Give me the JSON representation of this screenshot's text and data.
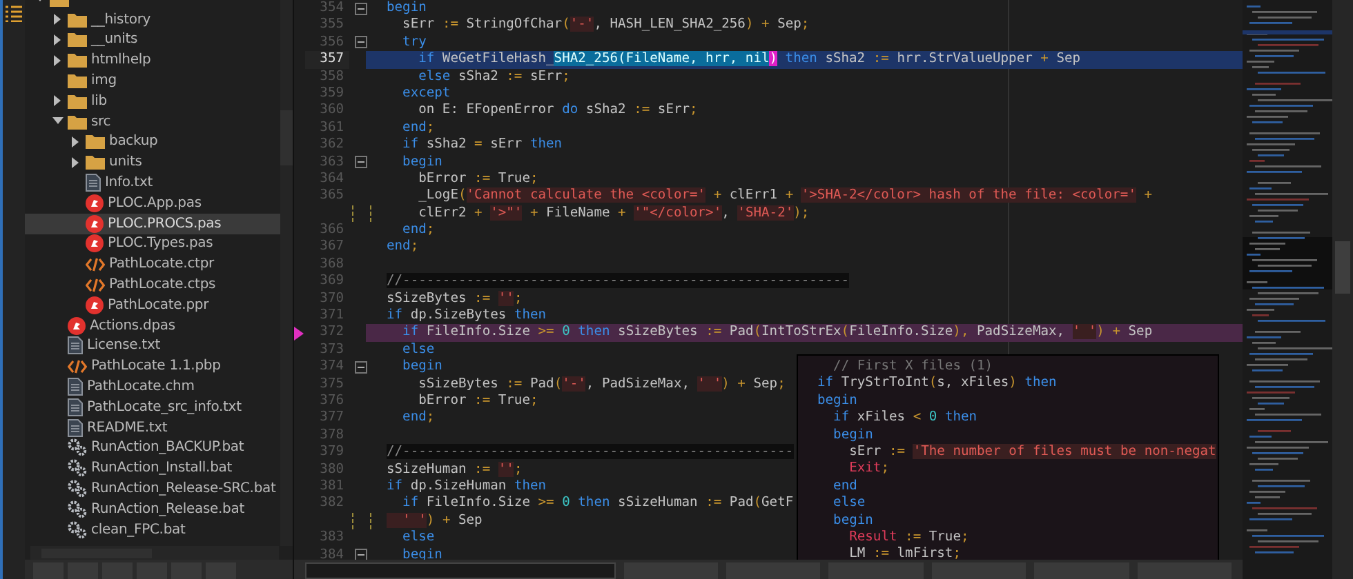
{
  "tree": {
    "items": [
      {
        "kind": "folder",
        "expanded": true,
        "selected": false,
        "children": [
          {
            "kind": "folder",
            "label": "__history",
            "expanded": false,
            "selected": false
          },
          {
            "kind": "folder",
            "label": "__units",
            "expanded": false,
            "selected": false
          },
          {
            "kind": "folder",
            "label": "htmlhelp",
            "expanded": false,
            "selected": false
          },
          {
            "kind": "folder",
            "label": "img",
            "selected": false
          },
          {
            "kind": "folder",
            "label": "lib",
            "expanded": false,
            "selected": false
          },
          {
            "kind": "folder",
            "label": "src",
            "expanded": true,
            "selected": false,
            "children": [
              {
                "kind": "folder",
                "label": "backup",
                "expanded": false,
                "selected": false
              },
              {
                "kind": "folder",
                "label": "units",
                "expanded": false,
                "selected": false
              },
              {
                "kind": "text",
                "label": "Info.txt",
                "selected": false
              },
              {
                "kind": "pascal",
                "label": "PLOC.App.pas",
                "selected": false
              },
              {
                "kind": "pascal",
                "label": "PLOC.PROCS.pas",
                "selected": true
              },
              {
                "kind": "pascal",
                "label": "PLOC.Types.pas",
                "selected": false
              },
              {
                "kind": "xml",
                "label": "PathLocate.ctpr",
                "selected": false
              },
              {
                "kind": "xml",
                "label": "PathLocate.ctps",
                "selected": false
              },
              {
                "kind": "pascal",
                "label": "PathLocate.ppr",
                "selected": false
              }
            ]
          },
          {
            "kind": "pascal",
            "label": "Actions.dpas",
            "selected": false
          },
          {
            "kind": "text",
            "label": "License.txt",
            "selected": false
          },
          {
            "kind": "xml",
            "label": "PathLocate 1.1.pbp",
            "selected": false
          },
          {
            "kind": "text",
            "label": "PathLocate.chm",
            "selected": false
          },
          {
            "kind": "text",
            "label": "PathLocate_src_info.txt",
            "selected": false
          },
          {
            "kind": "text",
            "label": "README.txt",
            "selected": false
          },
          {
            "kind": "gear",
            "label": "RunAction_BACKUP.bat",
            "selected": false
          },
          {
            "kind": "gear",
            "label": "RunAction_Install.bat",
            "selected": false
          },
          {
            "kind": "gear",
            "label": "RunAction_Release-SRC.bat",
            "selected": false
          },
          {
            "kind": "gear",
            "label": "RunAction_Release.bat",
            "selected": false
          },
          {
            "kind": "gear",
            "label": "clean_FPC.bat",
            "selected": false
          }
        ]
      }
    ]
  },
  "editor": {
    "lines": [
      {
        "kind": "code",
        "number": "354",
        "fold": true,
        "tokens": [
          {
            "kind": "kw",
            "text": "begin"
          }
        ]
      },
      {
        "kind": "code",
        "number": "355",
        "fold": false,
        "tokens": [
          {
            "kind": "id",
            "text": "  sErr "
          },
          {
            "kind": "op",
            "text": ":="
          },
          {
            "kind": "id",
            "text": " StringOfChar"
          },
          {
            "kind": "op",
            "text": "("
          },
          {
            "kind": "str",
            "text": "'-'"
          },
          {
            "kind": "id",
            "text": ", HASH_LEN_SHA2_256"
          },
          {
            "kind": "op",
            "text": ")"
          },
          {
            "kind": "op",
            "text": " +"
          },
          {
            "kind": "id",
            "text": " Sep"
          },
          {
            "kind": "op",
            "text": ";"
          }
        ]
      },
      {
        "kind": "code",
        "number": "356",
        "fold": true,
        "tokens": [
          {
            "kind": "kw",
            "text": "  try"
          }
        ]
      },
      {
        "kind": "current",
        "number": "357",
        "fold": false,
        "tokens": [
          {
            "kind": "kw",
            "text": "    if"
          },
          {
            "kind": "id",
            "text": " WeGetFileHash_"
          },
          {
            "kind": "match",
            "text": "SHA2_256(FileName, hrr, nil"
          },
          {
            "kind": "bracket",
            "text": ")"
          },
          {
            "kind": "kw",
            "text": " then"
          },
          {
            "kind": "id",
            "text": " sSha2 "
          },
          {
            "kind": "op",
            "text": ":="
          },
          {
            "kind": "id",
            "text": " hrr.StrValueUpper "
          },
          {
            "kind": "op",
            "text": "+"
          },
          {
            "kind": "id",
            "text": " Sep"
          }
        ]
      },
      {
        "kind": "code",
        "number": "358",
        "fold": false,
        "tokens": [
          {
            "kind": "kw",
            "text": "    else"
          },
          {
            "kind": "id",
            "text": " sSha2 "
          },
          {
            "kind": "op",
            "text": ":="
          },
          {
            "kind": "id",
            "text": " sErr"
          },
          {
            "kind": "op",
            "text": ";"
          }
        ]
      },
      {
        "kind": "code",
        "number": "359",
        "fold": false,
        "tokens": [
          {
            "kind": "kw",
            "text": "  except"
          }
        ]
      },
      {
        "kind": "code",
        "number": "360",
        "fold": false,
        "tokens": [
          {
            "kind": "id",
            "text": "    on E: EFopenError "
          },
          {
            "kind": "kw",
            "text": "do"
          },
          {
            "kind": "id",
            "text": " sSha2 "
          },
          {
            "kind": "op",
            "text": ":="
          },
          {
            "kind": "id",
            "text": " sErr"
          },
          {
            "kind": "op",
            "text": ";"
          }
        ]
      },
      {
        "kind": "code",
        "number": "361",
        "fold": false,
        "tokens": [
          {
            "kind": "kw",
            "text": "  end"
          },
          {
            "kind": "op",
            "text": ";"
          }
        ]
      },
      {
        "kind": "code",
        "number": "362",
        "fold": false,
        "tokens": [
          {
            "kind": "kw",
            "text": "  if"
          },
          {
            "kind": "id",
            "text": " sSha2 "
          },
          {
            "kind": "op",
            "text": "="
          },
          {
            "kind": "id",
            "text": " sErr "
          },
          {
            "kind": "kw",
            "text": "then"
          }
        ]
      },
      {
        "kind": "code",
        "number": "363",
        "fold": true,
        "tokens": [
          {
            "kind": "kw",
            "text": "  begin"
          }
        ]
      },
      {
        "kind": "code",
        "number": "364",
        "fold": false,
        "tokens": [
          {
            "kind": "id",
            "text": "    bError "
          },
          {
            "kind": "op",
            "text": ":="
          },
          {
            "kind": "id",
            "text": " True"
          },
          {
            "kind": "op",
            "text": ";"
          }
        ]
      },
      {
        "kind": "code",
        "number": "365",
        "fold": false,
        "tokens": [
          {
            "kind": "id",
            "text": "    _LogE"
          },
          {
            "kind": "op",
            "text": "("
          },
          {
            "kind": "str",
            "text": "'Cannot calculate the <color='"
          },
          {
            "kind": "op",
            "text": " +"
          },
          {
            "kind": "id",
            "text": " clErr1"
          },
          {
            "kind": "op",
            "text": " + "
          },
          {
            "kind": "str",
            "text": "'>SHA-2</color> hash of the file: <color='"
          },
          {
            "kind": "op",
            "text": " +"
          }
        ]
      },
      {
        "kind": "wrap",
        "fold": false,
        "tokens": [
          {
            "kind": "id",
            "text": "    clErr2"
          },
          {
            "kind": "op",
            "text": " + "
          },
          {
            "kind": "str",
            "text": "'>\"'"
          },
          {
            "kind": "op",
            "text": " +"
          },
          {
            "kind": "id",
            "text": " FileName"
          },
          {
            "kind": "op",
            "text": " + "
          },
          {
            "kind": "str",
            "text": "'\"</color>'"
          },
          {
            "kind": "id",
            "text": ", "
          },
          {
            "kind": "str",
            "text": "'SHA-2'"
          },
          {
            "kind": "op",
            "text": ");"
          }
        ]
      },
      {
        "kind": "code",
        "number": "366",
        "fold": false,
        "tokens": [
          {
            "kind": "kw",
            "text": "  end"
          },
          {
            "kind": "op",
            "text": ";"
          }
        ]
      },
      {
        "kind": "code",
        "number": "367",
        "fold": false,
        "tokens": [
          {
            "kind": "kw",
            "text": "end"
          },
          {
            "kind": "op",
            "text": ";"
          }
        ]
      },
      {
        "kind": "code",
        "number": "368",
        "fold": false
      },
      {
        "kind": "separator",
        "number": "369",
        "fold": false,
        "tokens": [
          {
            "kind": "cmt",
            "text": "//--------------------------------------------------------"
          }
        ]
      },
      {
        "kind": "code",
        "number": "370",
        "fold": false,
        "tokens": [
          {
            "kind": "id",
            "text": "sSizeBytes "
          },
          {
            "kind": "op",
            "text": ":= "
          },
          {
            "kind": "str",
            "text": "''"
          },
          {
            "kind": "op",
            "text": ";"
          }
        ]
      },
      {
        "kind": "code",
        "number": "371",
        "fold": false,
        "tokens": [
          {
            "kind": "kw",
            "text": "if"
          },
          {
            "kind": "id",
            "text": " dp.SizeBytes "
          },
          {
            "kind": "kw",
            "text": "then"
          }
        ]
      },
      {
        "kind": "breakpoint",
        "number": "372",
        "fold": false,
        "tokens": [
          {
            "kind": "kw",
            "text": "  if"
          },
          {
            "kind": "id",
            "text": " FileInfo.Size "
          },
          {
            "kind": "op",
            "text": ">="
          },
          {
            "kind": "num",
            "text": " 0"
          },
          {
            "kind": "kw",
            "text": " then"
          },
          {
            "kind": "id",
            "text": " sSizeBytes "
          },
          {
            "kind": "op",
            "text": ":="
          },
          {
            "kind": "id",
            "text": " Pad"
          },
          {
            "kind": "op",
            "text": "("
          },
          {
            "kind": "id",
            "text": "IntToStrEx"
          },
          {
            "kind": "op",
            "text": "("
          },
          {
            "kind": "id",
            "text": "FileInfo.Size"
          },
          {
            "kind": "op",
            "text": "),"
          },
          {
            "kind": "id",
            "text": " PadSizeMax, "
          },
          {
            "kind": "str",
            "text": "' '"
          },
          {
            "kind": "op",
            "text": ")"
          },
          {
            "kind": "op",
            "text": " +"
          },
          {
            "kind": "id",
            "text": " Sep"
          }
        ]
      },
      {
        "kind": "code",
        "number": "373",
        "fold": false,
        "tokens": [
          {
            "kind": "kw",
            "text": "  else"
          }
        ]
      },
      {
        "kind": "code",
        "number": "374",
        "fold": true,
        "tokens": [
          {
            "kind": "kw",
            "text": "  begin"
          }
        ]
      },
      {
        "kind": "code",
        "number": "375",
        "fold": false,
        "tokens": [
          {
            "kind": "id",
            "text": "    sSizeBytes "
          },
          {
            "kind": "op",
            "text": ":="
          },
          {
            "kind": "id",
            "text": " Pad"
          },
          {
            "kind": "op",
            "text": "("
          },
          {
            "kind": "str",
            "text": "'-'"
          },
          {
            "kind": "id",
            "text": ", PadSizeMax, "
          },
          {
            "kind": "str",
            "text": "' '"
          },
          {
            "kind": "op",
            "text": ")"
          },
          {
            "kind": "op",
            "text": " +"
          },
          {
            "kind": "id",
            "text": " Sep"
          },
          {
            "kind": "op",
            "text": ";"
          }
        ]
      },
      {
        "kind": "code",
        "number": "376",
        "fold": false,
        "tokens": [
          {
            "kind": "id",
            "text": "    bError "
          },
          {
            "kind": "op",
            "text": ":="
          },
          {
            "kind": "id",
            "text": " True"
          },
          {
            "kind": "op",
            "text": ";"
          }
        ]
      },
      {
        "kind": "code",
        "number": "377",
        "fold": false,
        "tokens": [
          {
            "kind": "kw",
            "text": "  end"
          },
          {
            "kind": "op",
            "text": ";"
          }
        ]
      },
      {
        "kind": "code",
        "number": "378",
        "fold": false
      },
      {
        "kind": "separator",
        "number": "379",
        "fold": false,
        "tokens": [
          {
            "kind": "cmt",
            "text": "//-------------------------------------------------"
          }
        ]
      },
      {
        "kind": "code",
        "number": "380",
        "fold": false,
        "tokens": [
          {
            "kind": "id",
            "text": "sSizeHuman "
          },
          {
            "kind": "op",
            "text": ":= "
          },
          {
            "kind": "str",
            "text": "''"
          },
          {
            "kind": "op",
            "text": ";"
          }
        ]
      },
      {
        "kind": "code",
        "number": "381",
        "fold": false,
        "tokens": [
          {
            "kind": "kw",
            "text": "if"
          },
          {
            "kind": "id",
            "text": " dp.SizeHuman "
          },
          {
            "kind": "kw",
            "text": "then"
          }
        ]
      },
      {
        "kind": "code",
        "number": "382",
        "fold": false,
        "tokens": [
          {
            "kind": "kw",
            "text": "  if"
          },
          {
            "kind": "id",
            "text": " FileInfo.Size "
          },
          {
            "kind": "op",
            "text": ">="
          },
          {
            "kind": "num",
            "text": " 0"
          },
          {
            "kind": "kw",
            "text": " then"
          },
          {
            "kind": "id",
            "text": " sSizeHuman "
          },
          {
            "kind": "op",
            "text": ":="
          },
          {
            "kind": "id",
            "text": " Pad"
          },
          {
            "kind": "op",
            "text": "("
          },
          {
            "kind": "id",
            "text": "GetF"
          }
        ]
      },
      {
        "kind": "wrap",
        "fold": false,
        "tokens": [
          {
            "kind": "str",
            "text": "  ' '"
          },
          {
            "kind": "op",
            "text": ")"
          },
          {
            "kind": "op",
            "text": " +"
          },
          {
            "kind": "id",
            "text": " Sep"
          }
        ]
      },
      {
        "kind": "code",
        "number": "383",
        "fold": false,
        "tokens": [
          {
            "kind": "kw",
            "text": "  else"
          }
        ]
      },
      {
        "kind": "code",
        "number": "384",
        "fold": true,
        "tokens": [
          {
            "kind": "kw",
            "text": "  begin"
          }
        ]
      }
    ]
  },
  "popup": {
    "lines": [
      {
        "tokens": [
          {
            "kind": "cmt",
            "text": "  // First X files (1)"
          }
        ]
      },
      {
        "tokens": [
          {
            "kind": "kw",
            "text": "if"
          },
          {
            "kind": "id",
            "text": " TryStrToInt"
          },
          {
            "kind": "op",
            "text": "("
          },
          {
            "kind": "id",
            "text": "s, xFiles"
          },
          {
            "kind": "op",
            "text": ")"
          },
          {
            "kind": "kw",
            "text": " then"
          }
        ]
      },
      {
        "tokens": [
          {
            "kind": "kw",
            "text": "begin"
          }
        ]
      },
      {
        "tokens": [
          {
            "kind": "kw",
            "text": "  if"
          },
          {
            "kind": "id",
            "text": " xFiles "
          },
          {
            "kind": "op",
            "text": "<"
          },
          {
            "kind": "num",
            "text": " 0"
          },
          {
            "kind": "kw",
            "text": " then"
          }
        ]
      },
      {
        "tokens": [
          {
            "kind": "kw",
            "text": "  begin"
          }
        ]
      },
      {
        "tokens": [
          {
            "kind": "id",
            "text": "    sErr "
          },
          {
            "kind": "op",
            "text": ":= "
          },
          {
            "kind": "str",
            "text": "'The number of files must be non-negat"
          }
        ]
      },
      {
        "tokens": [
          {
            "kind": "sym",
            "text": "    Exit"
          },
          {
            "kind": "op",
            "text": ";"
          }
        ]
      },
      {
        "tokens": [
          {
            "kind": "kw",
            "text": "  end"
          }
        ]
      },
      {
        "tokens": [
          {
            "kind": "kw",
            "text": "  else"
          }
        ]
      },
      {
        "tokens": [
          {
            "kind": "kw",
            "text": "  begin"
          }
        ]
      },
      {
        "tokens": [
          {
            "kind": "sym",
            "text": "    Result"
          },
          {
            "kind": "op",
            "text": " :="
          },
          {
            "kind": "id",
            "text": " True"
          },
          {
            "kind": "op",
            "text": ";"
          }
        ]
      },
      {
        "tokens": [
          {
            "kind": "id",
            "text": "    LM "
          },
          {
            "kind": "op",
            "text": ":="
          },
          {
            "kind": "id",
            "text": " lmFirst"
          },
          {
            "kind": "op",
            "text": ";"
          }
        ]
      }
    ]
  }
}
